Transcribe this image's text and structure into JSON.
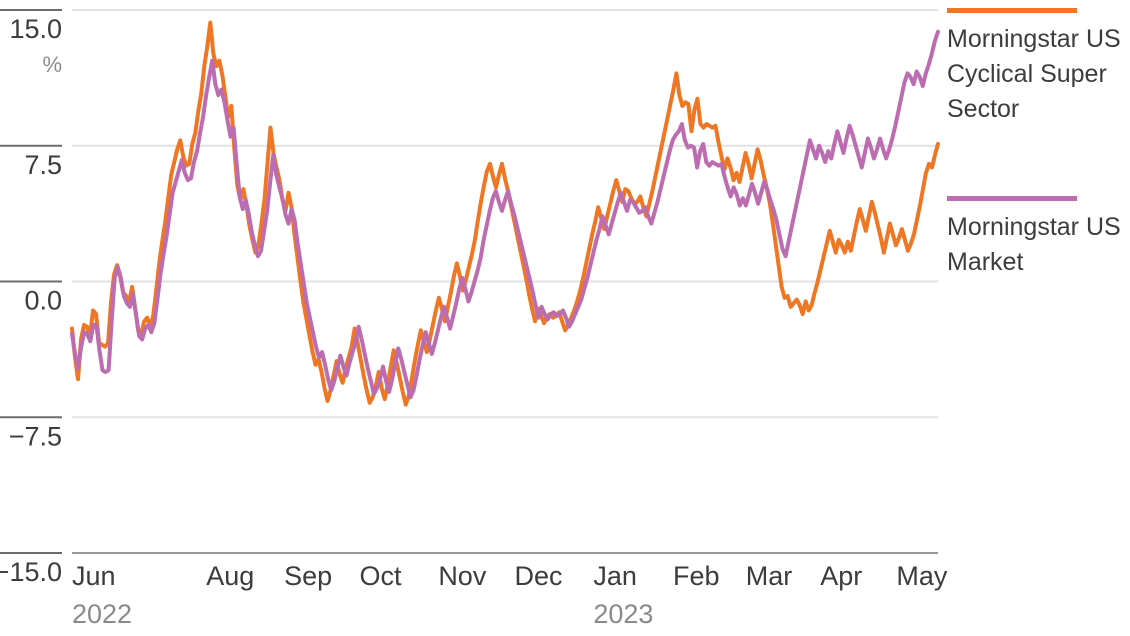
{
  "chart_data": {
    "type": "line",
    "title": "",
    "subtitle": "",
    "xlabel": "",
    "ylabel": "",
    "yunit": "%",
    "ylim": [
      -15.0,
      15.0
    ],
    "yticks": [
      15.0,
      7.5,
      0.0,
      -7.5,
      -15.0
    ],
    "ytick_labels": [
      "15.0",
      "7.5",
      "0.0",
      "−7.5",
      "−15.0"
    ],
    "grid": true,
    "legend_position": "right",
    "xtick_labels": [
      "Jun",
      "Aug",
      "Sep",
      "Oct",
      "Nov",
      "Dec",
      "Jan",
      "Feb",
      "Mar",
      "Apr",
      "May"
    ],
    "xtick_years": [
      "2022",
      "",
      "",
      "",
      "",
      "",
      "2023",
      "",
      "",
      "",
      ""
    ],
    "xtick_positions": [
      0.0,
      0.155,
      0.245,
      0.332,
      0.423,
      0.511,
      0.602,
      0.694,
      0.778,
      0.864,
      0.952
    ],
    "x_range_start": "2022-06-01",
    "x_range_end": "2023-05-31",
    "series": [
      {
        "name": "Morningstar US Cyclical Super Sector",
        "color": "#ef7622",
        "values": [
          -2.6,
          -4.2,
          -5.4,
          -3.2,
          -2.4,
          -2.5,
          -3.0,
          -1.6,
          -1.8,
          -3.4,
          -3.5,
          -3.6,
          -3.4,
          -1.1,
          0.4,
          0.9,
          0.3,
          -0.6,
          -0.8,
          -1.1,
          -0.3,
          -1.5,
          -2.7,
          -2.9,
          -2.2,
          -2.0,
          -2.5,
          -1.9,
          -0.5,
          1.0,
          2.2,
          3.3,
          4.6,
          5.9,
          6.6,
          7.3,
          7.8,
          6.9,
          6.4,
          6.5,
          7.6,
          8.2,
          9.4,
          10.4,
          11.9,
          13.0,
          14.3,
          12.6,
          11.9,
          12.2,
          11.4,
          10.2,
          9.1,
          9.7,
          7.3,
          5.3,
          4.5,
          5.1,
          4.2,
          3.1,
          2.3,
          1.6,
          2.0,
          3.2,
          4.5,
          6.5,
          8.5,
          7.1,
          6.3,
          5.6,
          4.5,
          3.9,
          4.9,
          4.1,
          2.6,
          1.3,
          0.0,
          -1.2,
          -2.1,
          -3.0,
          -3.9,
          -4.6,
          -4.3,
          -5.0,
          -5.9,
          -6.6,
          -6.0,
          -5.2,
          -4.4,
          -5.1,
          -5.6,
          -4.8,
          -4.2,
          -3.6,
          -2.6,
          -3.4,
          -4.3,
          -5.2,
          -6.0,
          -6.7,
          -6.4,
          -5.8,
          -5.0,
          -5.9,
          -6.5,
          -5.7,
          -4.7,
          -3.8,
          -4.5,
          -5.3,
          -6.1,
          -6.8,
          -6.3,
          -5.4,
          -4.4,
          -3.5,
          -2.7,
          -3.3,
          -3.9,
          -3.2,
          -2.4,
          -1.6,
          -0.9,
          -1.5,
          -2.2,
          -1.4,
          -0.6,
          0.3,
          1.0,
          0.3,
          -0.5,
          0.1,
          0.8,
          1.5,
          2.3,
          3.4,
          4.4,
          5.3,
          6.1,
          6.5,
          5.8,
          5.2,
          5.9,
          6.5,
          5.7,
          5.0,
          4.2,
          3.4,
          2.6,
          1.8,
          1.0,
          0.2,
          -0.7,
          -1.5,
          -2.2,
          -1.5,
          -1.9,
          -2.3,
          -1.9,
          -1.8,
          -2.0,
          -1.9,
          -1.7,
          -2.2,
          -2.7,
          -2.4,
          -2.0,
          -1.6,
          -1.1,
          -0.5,
          0.2,
          1.0,
          1.8,
          2.6,
          3.3,
          4.1,
          3.5,
          2.9,
          3.6,
          4.3,
          5.0,
          5.6,
          5.0,
          4.4,
          5.1,
          5.0,
          4.6,
          4.3,
          4.4,
          4.7,
          4.1,
          3.6,
          4.3,
          5.0,
          5.8,
          6.6,
          7.4,
          8.2,
          9.0,
          9.8,
          10.6,
          11.5,
          10.3,
          9.7,
          9.9,
          9.8,
          8.3,
          9.5,
          10.1,
          8.7,
          8.5,
          8.7,
          8.6,
          8.5,
          8.6,
          7.7,
          6.9,
          6.2,
          6.8,
          6.3,
          5.6,
          6.0,
          5.5,
          6.3,
          7.1,
          6.5,
          5.7,
          6.5,
          7.3,
          6.7,
          5.9,
          5.2,
          4.4,
          3.3,
          2.1,
          0.9,
          -0.3,
          -0.9,
          -0.8,
          -1.4,
          -1.2,
          -1.0,
          -1.3,
          -1.8,
          -1.1,
          -1.6,
          -1.3,
          -0.6,
          0.0,
          0.7,
          1.4,
          2.1,
          2.8,
          2.2,
          1.6,
          2.3,
          2.0,
          1.6,
          2.2,
          1.7,
          2.5,
          3.3,
          4.0,
          3.4,
          2.8,
          3.6,
          4.4,
          3.8,
          3.1,
          2.4,
          1.6,
          2.4,
          3.2,
          2.6,
          2.0,
          2.4,
          2.9,
          2.3,
          1.7,
          2.1,
          2.6,
          3.4,
          4.2,
          5.1,
          6.0,
          6.5,
          6.3,
          7.0,
          7.6
        ]
      },
      {
        "name": "Morningstar US Market",
        "color": "#bc6cb0",
        "values": [
          -2.9,
          -4.0,
          -4.8,
          -3.6,
          -2.8,
          -2.9,
          -3.3,
          -2.4,
          -2.4,
          -3.8,
          -4.9,
          -5.0,
          -4.9,
          -2.2,
          0.2,
          0.8,
          0.2,
          -0.8,
          -1.2,
          -1.4,
          -0.7,
          -1.8,
          -3.0,
          -3.2,
          -2.6,
          -2.4,
          -2.8,
          -2.3,
          -1.0,
          0.4,
          1.5,
          2.5,
          3.7,
          4.9,
          5.5,
          6.1,
          6.7,
          6.0,
          5.6,
          5.7,
          6.6,
          7.2,
          8.2,
          9.1,
          10.3,
          11.3,
          12.2,
          10.9,
          10.3,
          10.6,
          9.9,
          8.9,
          8.0,
          8.5,
          6.5,
          4.7,
          4.0,
          4.5,
          3.7,
          2.7,
          2.0,
          1.4,
          1.7,
          2.8,
          3.9,
          5.5,
          7.0,
          5.9,
          5.2,
          4.6,
          3.7,
          3.2,
          4.0,
          3.4,
          2.1,
          1.0,
          -0.1,
          -1.2,
          -2.0,
          -2.8,
          -3.6,
          -4.2,
          -3.9,
          -4.6,
          -5.4,
          -6.0,
          -5.5,
          -4.8,
          -4.1,
          -4.7,
          -5.2,
          -4.5,
          -3.9,
          -3.4,
          -2.5,
          -3.2,
          -4.0,
          -4.8,
          -5.5,
          -6.2,
          -5.9,
          -5.4,
          -4.7,
          -5.5,
          -6.1,
          -5.4,
          -4.5,
          -3.7,
          -4.3,
          -5.0,
          -5.7,
          -6.4,
          -6.0,
          -5.2,
          -4.3,
          -3.5,
          -2.8,
          -3.4,
          -4.0,
          -3.4,
          -2.7,
          -2.0,
          -1.4,
          -2.0,
          -2.6,
          -1.9,
          -1.2,
          -0.4,
          0.2,
          -0.4,
          -1.1,
          -0.6,
          0.0,
          0.6,
          1.3,
          2.3,
          3.1,
          3.9,
          4.6,
          5.0,
          4.4,
          3.9,
          4.5,
          5.0,
          4.3,
          3.7,
          3.0,
          2.3,
          1.6,
          0.9,
          0.2,
          -0.5,
          -1.3,
          -2.0,
          -1.4,
          -1.8,
          -2.1,
          -1.8,
          -1.7,
          -1.9,
          -1.8,
          -1.6,
          -2.0,
          -2.5,
          -2.2,
          -1.8,
          -1.4,
          -1.0,
          -0.4,
          0.2,
          0.9,
          1.6,
          2.3,
          2.9,
          3.6,
          3.1,
          2.6,
          3.2,
          3.8,
          4.4,
          4.9,
          4.4,
          3.9,
          4.5,
          4.4,
          4.1,
          3.8,
          3.9,
          4.1,
          3.6,
          3.2,
          3.8,
          4.4,
          5.1,
          5.8,
          6.5,
          7.2,
          7.8,
          8.1,
          8.3,
          8.7,
          7.8,
          7.4,
          7.5,
          7.4,
          6.3,
          7.2,
          7.6,
          6.6,
          6.4,
          6.6,
          6.5,
          6.4,
          6.5,
          5.8,
          5.2,
          4.7,
          5.2,
          4.8,
          4.2,
          4.6,
          4.2,
          4.8,
          5.4,
          4.9,
          4.3,
          4.9,
          5.5,
          5.1,
          4.5,
          4.0,
          3.4,
          2.6,
          1.8,
          1.4,
          2.2,
          3.0,
          3.8,
          4.6,
          5.4,
          6.2,
          7.0,
          7.8,
          7.3,
          6.8,
          7.5,
          7.1,
          6.6,
          7.2,
          6.8,
          7.6,
          8.3,
          7.7,
          7.1,
          7.9,
          8.6,
          8.1,
          7.5,
          6.9,
          6.3,
          7.1,
          7.9,
          7.4,
          6.8,
          7.3,
          7.9,
          7.3,
          6.8,
          7.3,
          7.9,
          8.6,
          9.4,
          10.2,
          11.0,
          11.5,
          11.3,
          10.9,
          11.6,
          11.3,
          10.8,
          11.5,
          12.0,
          12.6,
          13.3,
          13.8
        ]
      }
    ]
  },
  "legend": {
    "entries": [
      {
        "label": "Morningstar US Cyclical Super Sector",
        "color": "#ef7622"
      },
      {
        "label": "Morningstar US Market",
        "color": "#bc6cb0"
      }
    ]
  },
  "colors": {
    "series_orange": "#ef7622",
    "series_purple": "#bc6cb0",
    "gridline": "#e2e2e2",
    "tick": "#6b6b6b",
    "text": "#3c3c3c",
    "muted_text": "#8a8a8a"
  }
}
